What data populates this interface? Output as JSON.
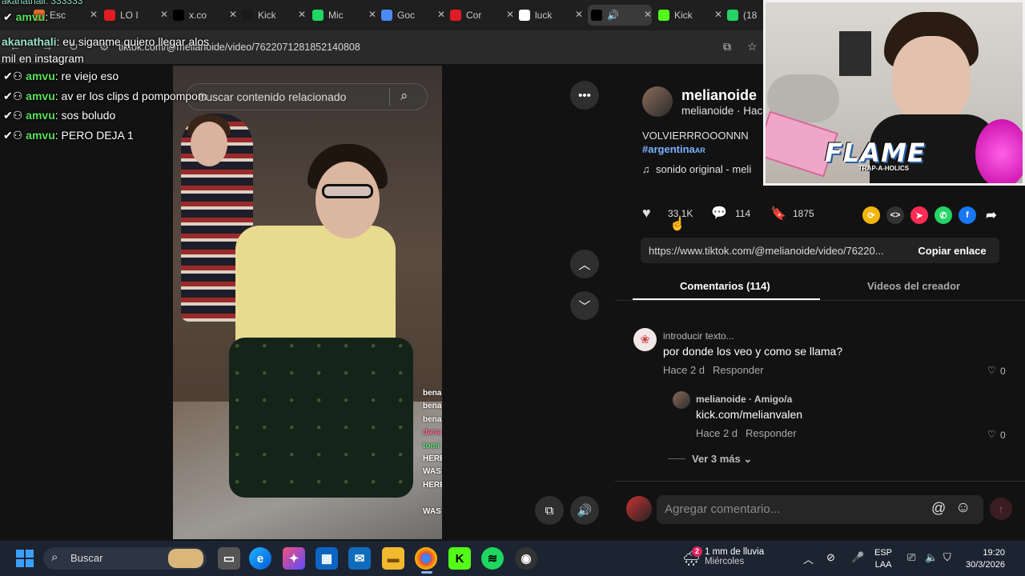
{
  "browser": {
    "tabs": [
      {
        "label": "Esc",
        "color": "#e66a2c",
        "icon": "notes-icon"
      },
      {
        "label": "LO I",
        "color": "#e01b24",
        "icon": "youtube-icon"
      },
      {
        "label": "x.co",
        "color": "#000000",
        "icon": "x-icon"
      },
      {
        "label": "Kick",
        "color": "#1a1a1a",
        "icon": "kick-icon"
      },
      {
        "label": "Mic",
        "color": "#1ed760",
        "icon": "kick-green-icon"
      },
      {
        "label": "Goc",
        "color": "#4c8bf5",
        "icon": "gemini-icon"
      },
      {
        "label": "Cor",
        "color": "#e01b24",
        "icon": "youtube-icon"
      },
      {
        "label": "luck",
        "color": "#ffffff",
        "icon": "google-icon"
      },
      {
        "label": "",
        "color": "#000000",
        "icon": "tiktok-icon"
      },
      {
        "label": "Kick",
        "color": "#53fc18",
        "icon": "kick-icon"
      },
      {
        "label": "(18",
        "color": "#25d366",
        "icon": "whatsapp-icon"
      }
    ],
    "url": "tiktok.com/@melianoide/video/7622071281852140808"
  },
  "chat_overlay": [
    {
      "user": "akanathali",
      "text": "eu siganme quiero llegar alos mil en instagram",
      "color": "#9be3c8"
    },
    {
      "user": "amvu",
      "text": "re viejo eso",
      "color": "#58e05a"
    },
    {
      "user": "amvu",
      "text": "av er los clips d pompompom",
      "color": "#58e05a"
    },
    {
      "user": "amvu",
      "text": "sos boludo",
      "color": "#58e05a"
    },
    {
      "user": "amvu",
      "text": "PERO DEJA 1",
      "color": "#58e05a"
    }
  ],
  "chat_top_user": "amvu",
  "chat_top_line": "akanathali: 333333",
  "video": {
    "search_placeholder": "Buscar contenido relacionado",
    "side_chat": [
      "bena",
      "bena",
      "bena",
      "dana",
      "tomi",
      "HERE",
      "WAS",
      "HERE",
      "",
      "WAS"
    ]
  },
  "post": {
    "author": "melianoide",
    "handle_line": "melianoide · Hac",
    "caption": "VOLVIERRROOONNN",
    "hashtag": "#argentina",
    "hashtag_flag": "AR",
    "sound": "sonido original - meli",
    "likes": "33.1K",
    "comments": "114",
    "saves": "1875",
    "link": "https://www.tiktok.com/@melianoide/video/76220...",
    "copy_label": "Copiar enlace",
    "tab_comments": "Comentarios (114)",
    "tab_creator": "Videos del creador"
  },
  "comments": [
    {
      "name": "introducir texto...",
      "text": "por donde los veo y como se llama?",
      "time": "Hace 2 d",
      "reply": "Responder",
      "likes": "0"
    },
    {
      "name": "melianoide · Amigo/a",
      "text": "kick.com/melianvalen",
      "time": "Hace 2 d",
      "reply": "Responder",
      "likes": "0"
    }
  ],
  "more_replies": "Ver 3 más",
  "comment_placeholder": "Agregar comentario...",
  "overlay": {
    "brand": "FLAME",
    "brand_sub": "TRAP-A-HOLICS"
  },
  "taskbar": {
    "search": "Buscar",
    "weather_badge": "2",
    "weather_line1": "1 mm de lluvia",
    "weather_line2": "Miércoles",
    "lang1": "ESP",
    "lang2": "LAA",
    "time": "19:20",
    "date": "30/3/2026"
  }
}
